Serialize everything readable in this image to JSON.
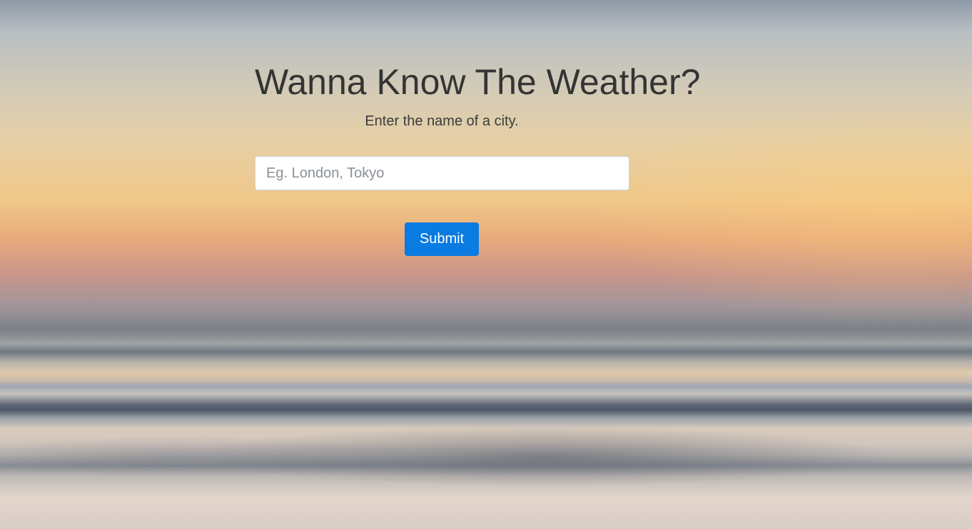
{
  "page": {
    "title": "Wanna Know The Weather?",
    "subtitle": "Enter the name of a city."
  },
  "form": {
    "city_value": "",
    "city_placeholder": "Eg. London, Tokyo",
    "submit_label": "Submit"
  },
  "colors": {
    "submit_button": "#0a7be0",
    "title_text": "#343434"
  }
}
